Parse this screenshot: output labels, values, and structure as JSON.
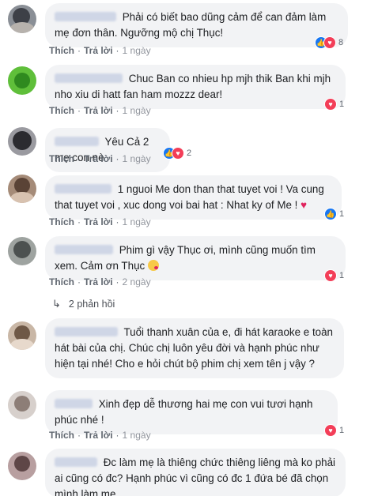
{
  "labels": {
    "like": "Thích",
    "reply": "Trả lời",
    "sep": "·"
  },
  "comments": [
    {
      "text": "Phải có biết bao dũng cảm để can đảm làm mẹ đơn thân. Ngưỡng mộ chị Thục!",
      "time": "1 ngày",
      "reactions": {
        "types": [
          "like",
          "love"
        ],
        "count": "8"
      }
    },
    {
      "text": "Chuc Ban co nhieu hp mjh thik Ban khi mjh nho xiu di hatt fan ham mozzz dear!",
      "time": "1 ngày",
      "reactions": {
        "types": [
          "love"
        ],
        "count": "1"
      }
    },
    {
      "text": "Yêu Cả 2 mẹ con nè",
      "time": "1 ngày",
      "reactions": {
        "types": [
          "like",
          "love"
        ],
        "count": "2"
      }
    },
    {
      "text": "1 nguoi Me don than that tuyet voi ! Va cung that tuyet voi , xuc dong voi bai hat : Nhat ky of Me !",
      "emoji": "♥",
      "time": "1 ngày",
      "reactions": {
        "types": [
          "like"
        ],
        "count": "1"
      }
    },
    {
      "text": "Phim gì vậy Thục ơi, mình cũng muốn tìm xem. Cảm ơn Thục",
      "emoji": "kiss",
      "time": "2 ngày",
      "reactions": {
        "types": [
          "love"
        ],
        "count": "1"
      }
    },
    {
      "text": "Tuổi thanh xuân của e, đi hát karaoke e toàn hát bài của chị. Chúc chị luôn yêu đời và hạnh phúc như hiện tại nhé! Cho e hỏi chút bộ phim chị xem tên j vậy ?",
      "time": "",
      "reactions": null
    },
    {
      "text": "Xinh đẹp dễ thương hai mẹ con vui tươi hạnh phúc nhé !",
      "time": "1 ngày",
      "reactions": {
        "types": [
          "love"
        ],
        "count": "1"
      }
    },
    {
      "text": "Đc làm mẹ là thiêng chức thiêng liêng mà ko phải ai cũng có đc? Hạnh phúc vì cũng có đc 1 đứa bé đã chọn mình làm mẹ.",
      "time": "",
      "reactions": null
    }
  ],
  "replies": {
    "arrow": "↳",
    "label": "2 phản hồi"
  },
  "colors": {
    "like": "#1877f2",
    "love": "#f33e58",
    "bubble": "#f2f3f5",
    "meta": "#606770"
  }
}
